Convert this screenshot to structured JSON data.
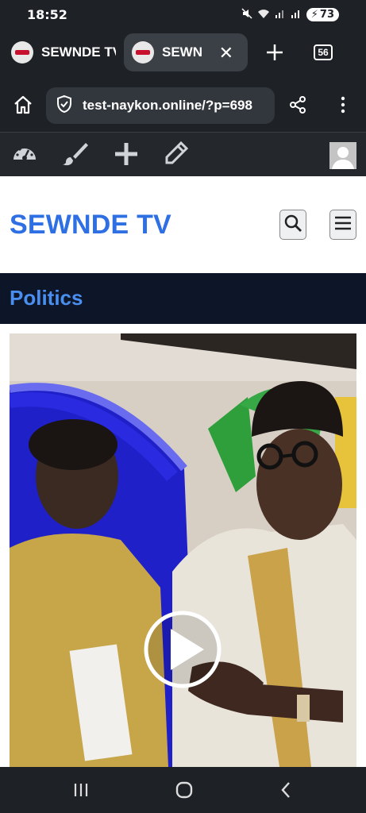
{
  "status_bar": {
    "time": "18:52",
    "battery": "73"
  },
  "tabs": [
    {
      "label": "SEWNDE TV"
    },
    {
      "label": "SEWNDE TV",
      "active": true
    }
  ],
  "tab_count": "56",
  "address_bar": {
    "url": "test-naykon.online/?p=698"
  },
  "site": {
    "title": "SEWNDE TV",
    "category": "Politics"
  },
  "colors": {
    "brand_blue": "#2f6fe4",
    "category_bg": "#0d1628",
    "chrome_dark": "#1e2227"
  },
  "icons": [
    "home-icon",
    "shield-icon",
    "share-icon",
    "more-icon",
    "dashboard-icon",
    "brush-icon",
    "plus-icon",
    "pencil-icon",
    "search-icon",
    "menu-icon",
    "play-icon"
  ]
}
